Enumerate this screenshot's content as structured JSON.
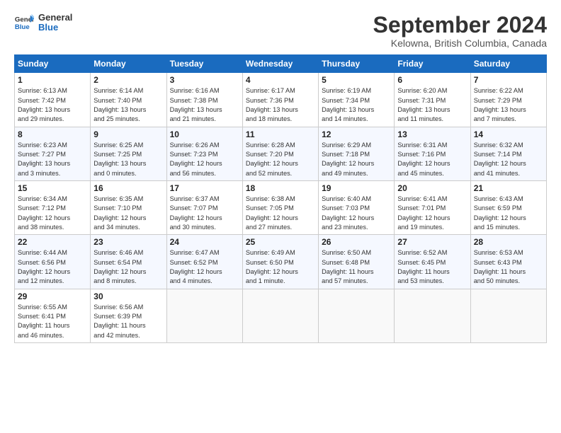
{
  "header": {
    "logo_line1": "General",
    "logo_line2": "Blue",
    "month": "September 2024",
    "location": "Kelowna, British Columbia, Canada"
  },
  "weekdays": [
    "Sunday",
    "Monday",
    "Tuesday",
    "Wednesday",
    "Thursday",
    "Friday",
    "Saturday"
  ],
  "weeks": [
    [
      {
        "day": "1",
        "lines": [
          "Sunrise: 6:13 AM",
          "Sunset: 7:42 PM",
          "Daylight: 13 hours",
          "and 29 minutes."
        ]
      },
      {
        "day": "2",
        "lines": [
          "Sunrise: 6:14 AM",
          "Sunset: 7:40 PM",
          "Daylight: 13 hours",
          "and 25 minutes."
        ]
      },
      {
        "day": "3",
        "lines": [
          "Sunrise: 6:16 AM",
          "Sunset: 7:38 PM",
          "Daylight: 13 hours",
          "and 21 minutes."
        ]
      },
      {
        "day": "4",
        "lines": [
          "Sunrise: 6:17 AM",
          "Sunset: 7:36 PM",
          "Daylight: 13 hours",
          "and 18 minutes."
        ]
      },
      {
        "day": "5",
        "lines": [
          "Sunrise: 6:19 AM",
          "Sunset: 7:34 PM",
          "Daylight: 13 hours",
          "and 14 minutes."
        ]
      },
      {
        "day": "6",
        "lines": [
          "Sunrise: 6:20 AM",
          "Sunset: 7:31 PM",
          "Daylight: 13 hours",
          "and 11 minutes."
        ]
      },
      {
        "day": "7",
        "lines": [
          "Sunrise: 6:22 AM",
          "Sunset: 7:29 PM",
          "Daylight: 13 hours",
          "and 7 minutes."
        ]
      }
    ],
    [
      {
        "day": "8",
        "lines": [
          "Sunrise: 6:23 AM",
          "Sunset: 7:27 PM",
          "Daylight: 13 hours",
          "and 3 minutes."
        ]
      },
      {
        "day": "9",
        "lines": [
          "Sunrise: 6:25 AM",
          "Sunset: 7:25 PM",
          "Daylight: 13 hours",
          "and 0 minutes."
        ]
      },
      {
        "day": "10",
        "lines": [
          "Sunrise: 6:26 AM",
          "Sunset: 7:23 PM",
          "Daylight: 12 hours",
          "and 56 minutes."
        ]
      },
      {
        "day": "11",
        "lines": [
          "Sunrise: 6:28 AM",
          "Sunset: 7:20 PM",
          "Daylight: 12 hours",
          "and 52 minutes."
        ]
      },
      {
        "day": "12",
        "lines": [
          "Sunrise: 6:29 AM",
          "Sunset: 7:18 PM",
          "Daylight: 12 hours",
          "and 49 minutes."
        ]
      },
      {
        "day": "13",
        "lines": [
          "Sunrise: 6:31 AM",
          "Sunset: 7:16 PM",
          "Daylight: 12 hours",
          "and 45 minutes."
        ]
      },
      {
        "day": "14",
        "lines": [
          "Sunrise: 6:32 AM",
          "Sunset: 7:14 PM",
          "Daylight: 12 hours",
          "and 41 minutes."
        ]
      }
    ],
    [
      {
        "day": "15",
        "lines": [
          "Sunrise: 6:34 AM",
          "Sunset: 7:12 PM",
          "Daylight: 12 hours",
          "and 38 minutes."
        ]
      },
      {
        "day": "16",
        "lines": [
          "Sunrise: 6:35 AM",
          "Sunset: 7:10 PM",
          "Daylight: 12 hours",
          "and 34 minutes."
        ]
      },
      {
        "day": "17",
        "lines": [
          "Sunrise: 6:37 AM",
          "Sunset: 7:07 PM",
          "Daylight: 12 hours",
          "and 30 minutes."
        ]
      },
      {
        "day": "18",
        "lines": [
          "Sunrise: 6:38 AM",
          "Sunset: 7:05 PM",
          "Daylight: 12 hours",
          "and 27 minutes."
        ]
      },
      {
        "day": "19",
        "lines": [
          "Sunrise: 6:40 AM",
          "Sunset: 7:03 PM",
          "Daylight: 12 hours",
          "and 23 minutes."
        ]
      },
      {
        "day": "20",
        "lines": [
          "Sunrise: 6:41 AM",
          "Sunset: 7:01 PM",
          "Daylight: 12 hours",
          "and 19 minutes."
        ]
      },
      {
        "day": "21",
        "lines": [
          "Sunrise: 6:43 AM",
          "Sunset: 6:59 PM",
          "Daylight: 12 hours",
          "and 15 minutes."
        ]
      }
    ],
    [
      {
        "day": "22",
        "lines": [
          "Sunrise: 6:44 AM",
          "Sunset: 6:56 PM",
          "Daylight: 12 hours",
          "and 12 minutes."
        ]
      },
      {
        "day": "23",
        "lines": [
          "Sunrise: 6:46 AM",
          "Sunset: 6:54 PM",
          "Daylight: 12 hours",
          "and 8 minutes."
        ]
      },
      {
        "day": "24",
        "lines": [
          "Sunrise: 6:47 AM",
          "Sunset: 6:52 PM",
          "Daylight: 12 hours",
          "and 4 minutes."
        ]
      },
      {
        "day": "25",
        "lines": [
          "Sunrise: 6:49 AM",
          "Sunset: 6:50 PM",
          "Daylight: 12 hours",
          "and 1 minute."
        ]
      },
      {
        "day": "26",
        "lines": [
          "Sunrise: 6:50 AM",
          "Sunset: 6:48 PM",
          "Daylight: 11 hours",
          "and 57 minutes."
        ]
      },
      {
        "day": "27",
        "lines": [
          "Sunrise: 6:52 AM",
          "Sunset: 6:45 PM",
          "Daylight: 11 hours",
          "and 53 minutes."
        ]
      },
      {
        "day": "28",
        "lines": [
          "Sunrise: 6:53 AM",
          "Sunset: 6:43 PM",
          "Daylight: 11 hours",
          "and 50 minutes."
        ]
      }
    ],
    [
      {
        "day": "29",
        "lines": [
          "Sunrise: 6:55 AM",
          "Sunset: 6:41 PM",
          "Daylight: 11 hours",
          "and 46 minutes."
        ]
      },
      {
        "day": "30",
        "lines": [
          "Sunrise: 6:56 AM",
          "Sunset: 6:39 PM",
          "Daylight: 11 hours",
          "and 42 minutes."
        ]
      },
      {
        "day": "",
        "lines": []
      },
      {
        "day": "",
        "lines": []
      },
      {
        "day": "",
        "lines": []
      },
      {
        "day": "",
        "lines": []
      },
      {
        "day": "",
        "lines": []
      }
    ]
  ]
}
